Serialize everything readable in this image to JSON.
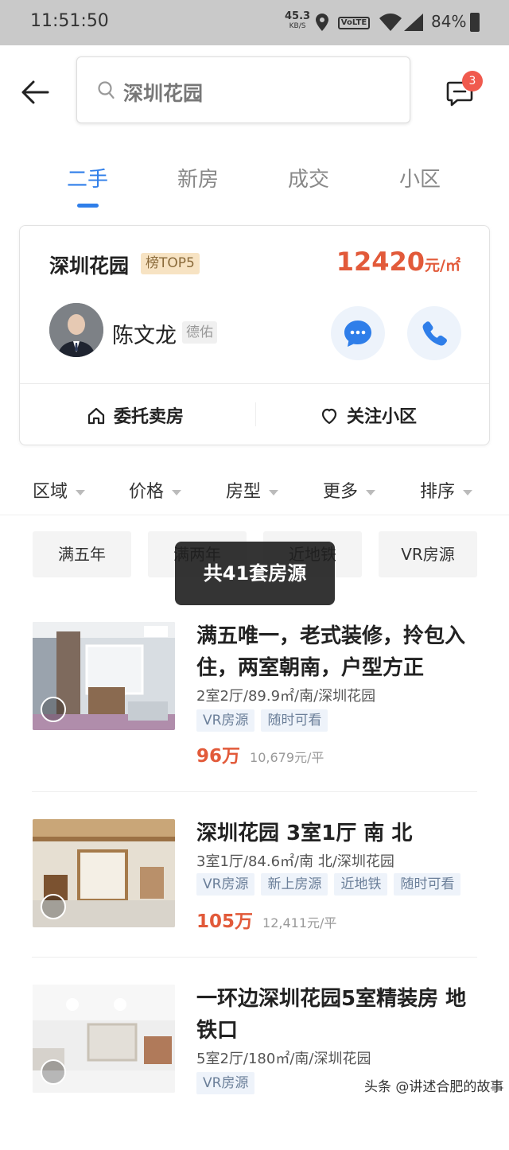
{
  "status_bar": {
    "time": "11:51:50",
    "net_speed": "45.3",
    "net_unit": "KB/S",
    "volte": "VoLTE",
    "battery": "84%"
  },
  "search": {
    "value": "深圳花园"
  },
  "messages": {
    "badge_count": "3"
  },
  "tabs": [
    {
      "label": "二手",
      "active": true
    },
    {
      "label": "新房",
      "active": false
    },
    {
      "label": "成交",
      "active": false
    },
    {
      "label": "小区",
      "active": false
    }
  ],
  "community_card": {
    "name": "深圳花园",
    "rank_badge": "榜TOP5",
    "price": "12420",
    "price_unit": "元/㎡",
    "agent_name": "陈文龙",
    "agent_company": "德佑",
    "action_sell": "委托卖房",
    "action_follow": "关注小区"
  },
  "filters": [
    "区域",
    "价格",
    "房型",
    "更多",
    "排序"
  ],
  "chips": [
    "满五年",
    "满两年",
    "近地铁",
    "VR房源"
  ],
  "toast": "共41套房源",
  "listings": [
    {
      "title": "满五唯一，老式装修，拎包入住，两室朝南，户型方正",
      "meta": "2室2厅/89.9㎡/南/深圳花园",
      "tags": [
        "VR房源",
        "随时可看"
      ],
      "price": "96万",
      "unit_price": "10,679元/平"
    },
    {
      "title": "深圳花园 3室1厅 南 北",
      "meta": "3室1厅/84.6㎡/南 北/深圳花园",
      "tags": [
        "VR房源",
        "新上房源",
        "近地铁",
        "随时可看"
      ],
      "price": "105万",
      "unit_price": "12,411元/平"
    },
    {
      "title": "一环边深圳花园5室精装房 地铁口",
      "meta": "5室2厅/180㎡/南/深圳花园",
      "tags": [
        "VR房源"
      ],
      "price": "",
      "unit_price": ""
    }
  ],
  "watermark": "头条 @讲述合肥的故事",
  "colors": {
    "accent": "#2f7ee9",
    "price": "#e25a3a",
    "badge": "#f05a4e"
  }
}
